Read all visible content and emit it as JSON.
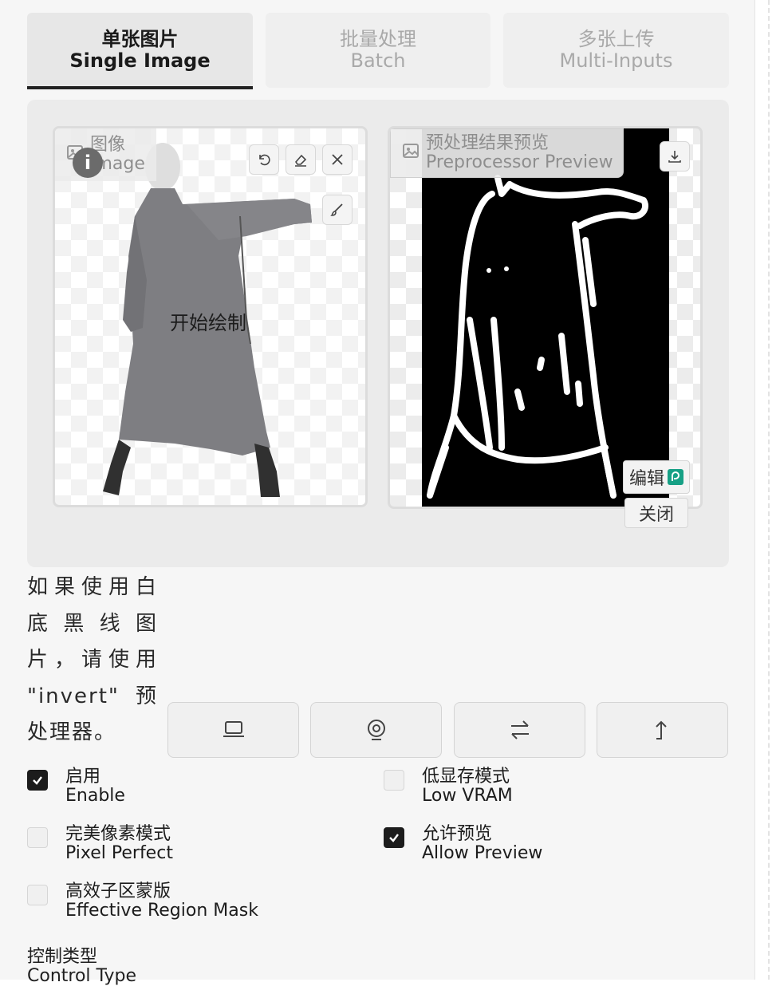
{
  "tabs": [
    {
      "zh": "单张图片",
      "en": "Single Image",
      "active": true
    },
    {
      "zh": "批量处理",
      "en": "Batch",
      "active": false
    },
    {
      "zh": "多张上传",
      "en": "Multi-Inputs",
      "active": false
    }
  ],
  "input_image": {
    "label_zh": "图像",
    "label_en": "Image",
    "overlay_text": "开始绘制",
    "icon": "image-icon"
  },
  "preview_image": {
    "label_zh": "预处理结果预览",
    "label_en": "Preprocessor Preview",
    "icon": "image-icon"
  },
  "preview_buttons": {
    "edit": "编辑",
    "close": "关闭"
  },
  "hint_text": "如果使用白底黑线图片，请使用 \"invert\" 预处理器。",
  "source_buttons": [
    "laptop-icon",
    "webcam-icon",
    "swap-icon",
    "upload-arrow-icon"
  ],
  "options": {
    "enable": {
      "zh": "启用",
      "en": "Enable",
      "checked": true
    },
    "low_vram": {
      "zh": "低显存模式",
      "en": "Low VRAM",
      "checked": false
    },
    "pixel_perfect": {
      "zh": "完美像素模式",
      "en": "Pixel Perfect",
      "checked": false
    },
    "allow_preview": {
      "zh": "允许预览",
      "en": "Allow Preview",
      "checked": true
    },
    "effective_region_mask": {
      "zh": "高效子区蒙版",
      "en": "Effective Region Mask",
      "checked": false
    }
  },
  "control_type": {
    "zh": "控制类型",
    "en": "Control Type"
  },
  "colors": {
    "accent": "#1c1c1c",
    "panel_bg": "#f6f6f6",
    "area_bg": "#ebebeb"
  }
}
